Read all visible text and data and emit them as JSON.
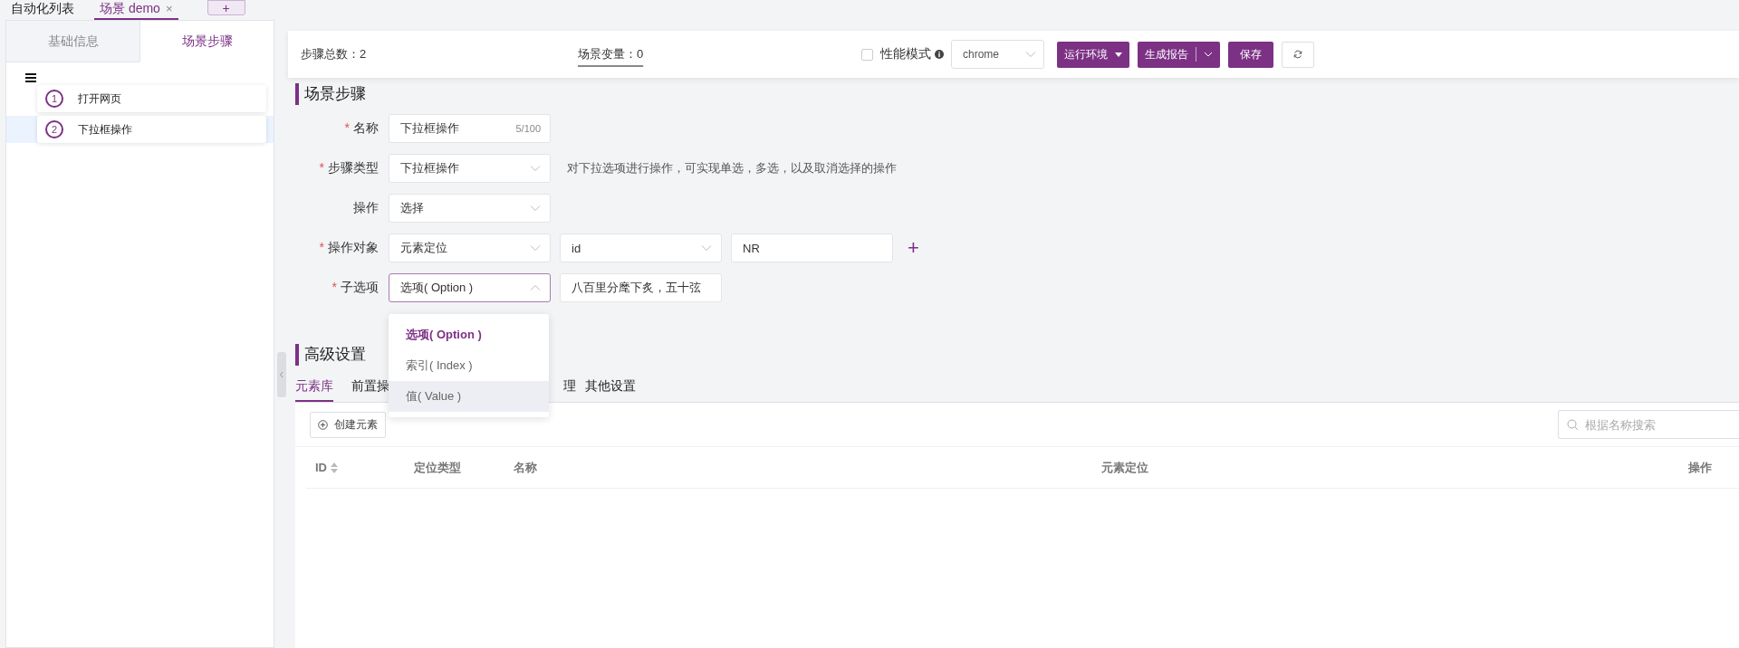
{
  "top_tabs": [
    {
      "label": "自动化列表",
      "selected": false
    },
    {
      "label": "场景 demo",
      "selected": true,
      "close": "×"
    }
  ],
  "add_tab": "+",
  "sidebar": {
    "tabs": [
      {
        "label": "基础信息",
        "selected": false
      },
      {
        "label": "场景步骤",
        "selected": true
      }
    ],
    "steps": [
      {
        "number": "1",
        "label": "打开网页",
        "selected": false
      },
      {
        "number": "2",
        "label": "下拉框操作",
        "selected": true
      }
    ]
  },
  "toolbar": {
    "step_total": "步骤总数：2",
    "scene_vars": "场景变量：0",
    "perf_mode": {
      "label": "性能模式",
      "checked": false
    },
    "browser": "chrome",
    "buttons": [
      {
        "kind": "dropdown",
        "label": "运行环境"
      },
      {
        "kind": "split",
        "label": "生成报告"
      },
      {
        "kind": "primary",
        "label": "保存"
      },
      {
        "kind": "refresh"
      }
    ]
  },
  "step_form": {
    "title": "场景步骤",
    "fields": [
      {
        "mark": "*",
        "label": "名称",
        "controls": [
          {
            "kind": "input",
            "value": "下拉框操作",
            "counter": "5/100"
          }
        ]
      },
      {
        "mark": "*",
        "label": "步骤类型",
        "controls": [
          {
            "kind": "select",
            "value": "下拉框操作",
            "open": false
          }
        ],
        "hint": "对下拉选项进行操作，可实现单选，多选，以及取消选择的操作"
      },
      {
        "label": "操作",
        "controls": [
          {
            "kind": "select",
            "value": "选择",
            "open": false
          }
        ]
      },
      {
        "mark": "*",
        "label": "操作对象",
        "controls": [
          {
            "kind": "select",
            "value": "元素定位",
            "open": false
          },
          {
            "kind": "select",
            "value": "id",
            "open": false
          },
          {
            "kind": "input",
            "value": "NR"
          }
        ],
        "add": "+"
      },
      {
        "mark": "*",
        "label": "子选项",
        "controls": [
          {
            "kind": "select",
            "value": "选项( Option )",
            "open": true
          },
          {
            "kind": "input",
            "value": "八百里分麾下炙，五十弦"
          }
        ]
      }
    ],
    "dropdown_options": [
      {
        "label": "选项( Option )",
        "selected": true,
        "hovered": false
      },
      {
        "label": "索引( Index )",
        "selected": false,
        "hovered": false
      },
      {
        "label": "值( Value )",
        "selected": false,
        "hovered": true
      }
    ]
  },
  "advanced": {
    "title": "高级设置",
    "tabs": [
      {
        "label": "元素库",
        "selected": true
      },
      {
        "label": "前置操",
        "selected": false
      },
      {
        "label": "理",
        "selected": false
      },
      {
        "label": "其他设置",
        "selected": false
      }
    ],
    "create_button": "创建元素",
    "search": {
      "placeholder": "根据名称搜索"
    },
    "table": {
      "columns": [
        {
          "label": "ID",
          "sortable": true
        },
        {
          "label": "定位类型",
          "sortable": false
        },
        {
          "label": "名称",
          "sortable": false
        },
        {
          "label": "元素定位",
          "sortable": false
        },
        {
          "label": "操作",
          "sortable": false
        }
      ]
    }
  }
}
